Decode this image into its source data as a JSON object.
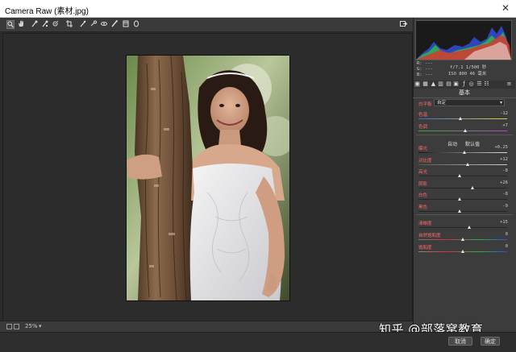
{
  "window": {
    "title": "Camera Raw (素材.jpg)",
    "close_glyph": "✕"
  },
  "toolbar": {
    "tools": [
      "zoom-tool",
      "hand-tool",
      "white-balance-tool",
      "color-sampler-tool",
      "target-adjustment-tool",
      "crop-tool",
      "straighten-tool",
      "spot-removal-tool",
      "red-eye-tool",
      "adjustment-brush-tool",
      "graduated-filter-tool",
      "radial-filter-tool"
    ],
    "export_icon": "open-preferences-icon"
  },
  "bottom_bar": {
    "zoom": "25%"
  },
  "info": {
    "r_label": "R:",
    "g_label": "G:",
    "b_label": "B:",
    "r_val": "---",
    "g_val": "---",
    "b_val": "---",
    "camera_line1": "f/7.1   1/500 秒",
    "camera_line2": "ISO 800   46 毫米"
  },
  "panel": {
    "section_title": "基本",
    "white_balance_label": "白平衡",
    "white_balance_value": "自定",
    "auto_label": "自动",
    "default_label": "默认值",
    "sliders_top": [
      {
        "label": "色温",
        "value": "-12",
        "pos": 0.47
      },
      {
        "label": "色调",
        "value": "+7",
        "pos": 0.53
      }
    ],
    "sliders_tone": [
      {
        "label": "曝光",
        "value": "+0.25",
        "pos": 0.52
      },
      {
        "label": "对比度",
        "value": "+12",
        "pos": 0.55
      },
      {
        "label": "高光",
        "value": "-8",
        "pos": 0.46
      },
      {
        "label": "阴影",
        "value": "+26",
        "pos": 0.61
      },
      {
        "label": "白色",
        "value": "-8",
        "pos": 0.46
      },
      {
        "label": "黑色",
        "value": "-9",
        "pos": 0.46
      }
    ],
    "sliders_presence": [
      {
        "label": "清晰度",
        "value": "+15",
        "pos": 0.57
      },
      {
        "label": "自然饱和度",
        "value": "0",
        "pos": 0.5
      },
      {
        "label": "饱和度",
        "value": "0",
        "pos": 0.5
      }
    ]
  },
  "watermark": "知乎 @部落窝教育",
  "buttons": {
    "cancel": "取消",
    "ok": "确定"
  }
}
